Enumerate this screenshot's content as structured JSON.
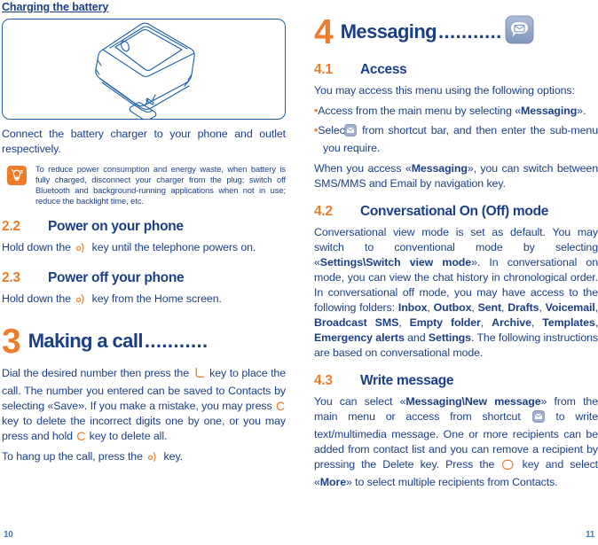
{
  "left_page": {
    "heading": "Charging the battery",
    "illustration_name": "phone-with-charger-illustration",
    "intro": "Connect the battery charger to your phone and outlet respectively.",
    "note": {
      "icon": "tip-bulb-icon",
      "text": "To reduce power consumption and energy waste, when battery is fully charged, disconnect your charger from the plug; switch off Bluetooth and background-running applications when not in use; reduce the backlight time, etc."
    },
    "sections": [
      {
        "number": "2.2",
        "title": "Power on your phone",
        "text_before": "Hold down the ",
        "key_icon": "power-key-icon",
        "text_after": " key until the telephone powers on."
      },
      {
        "number": "2.3",
        "title": "Power off your phone",
        "text_before": "Hold down the ",
        "key_icon": "power-key-icon",
        "text_after": " key from the Home screen."
      }
    ],
    "chapter": {
      "number": "3",
      "title": "Making a call",
      "dots": "...........",
      "paragraph_1a": "Dial the desired number then press the ",
      "call_key_icon": "call-key-icon",
      "paragraph_1b": " key to place the call. The number you entered can be saved to Contacts by selecting «Save».  If you make a mistake, you may press ",
      "clear_key_glyph": "C",
      "paragraph_1c": " key to delete the incorrect digits one by one,  or you may press and hold ",
      "paragraph_1d": " key to delete all.",
      "paragraph_2a": "To hang up the call, press the ",
      "end_key_icon": "power-key-icon",
      "paragraph_2b": " key."
    },
    "page_number": "10"
  },
  "right_page": {
    "chapter": {
      "number": "4",
      "title": "Messaging",
      "dots": "...........",
      "icon": "messaging-envelope-icon"
    },
    "sections": [
      {
        "number": "4.1",
        "title": "Access",
        "intro": "You may access this menu using the following options:",
        "bullets": [
          {
            "dot": "•",
            "text_a": "Access from the main menu by selecting «",
            "bold": "Messaging",
            "text_b": "»."
          },
          {
            "dot": "•",
            "text_a": "Select ",
            "icon": "messaging-shortcut-icon",
            "text_b": " from shortcut bar, and then enter the sub-menu you require."
          }
        ],
        "closing_a": "When you access «",
        "closing_bold": "Messaging",
        "closing_b": "», you can switch between SMS/MMS and Email by navigation key."
      },
      {
        "number": "4.2",
        "title": "Conversational On (Off) mode",
        "p_a": "Conversational view mode is set as default. You may switch to conventional mode by selecting «",
        "p_bold_1": "Settings\\Switch view mode",
        "p_b": "». In conversational on mode, you can view the  chat history in chronological order. In conversational off mode, you may have access to the following folders: ",
        "folders": [
          "Inbox",
          "Outbox",
          "Sent",
          "Drafts",
          "Voicemail",
          "Broadcast SMS",
          "Empty folder",
          "Archive",
          "Templates",
          "Emergency alerts"
        ],
        "folders_conjunction": " and ",
        "folders_last": "Settings",
        "p_c": ". The following instructions are based on conversational mode."
      },
      {
        "number": "4.3",
        "title": "Write message",
        "p_a": "You can select «",
        "p_bold_1": "Messaging\\New message",
        "p_b": "» from the main menu or access from shortcut ",
        "icon": "messaging-shortcut-icon",
        "p_c": " to write text/multimedia message. One or more recipients can be added from contact list and you can remove a recipient by pressing the Delete key. Press the ",
        "soft_key_icon": "soft-key-icon",
        "p_d": " key and select «",
        "p_bold_2": "More",
        "p_e": "» to select multiple recipients from Contacts."
      }
    ],
    "page_number": "11"
  },
  "colors": {
    "heading_blue": "#1b3f87",
    "accent_orange": "#ef7c2a",
    "illustration_blue": "#1b5fa8",
    "page_number_blue": "#3f79bd",
    "icon_blue_grey": "#8ea4c8"
  }
}
